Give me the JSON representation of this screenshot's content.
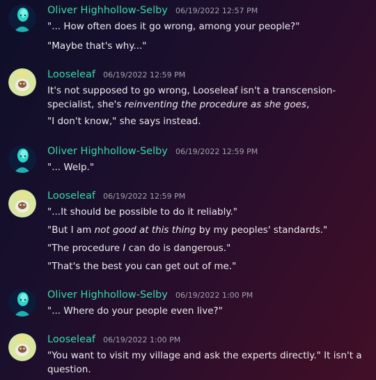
{
  "messages": [
    {
      "author": "Oliver Highhollow-Selby",
      "timestamp": "06/19/2022 12:57 PM",
      "lines": [
        "\"... How often does it go wrong, among your people?\"",
        "\"Maybe that's why...\""
      ]
    },
    {
      "author": "Looseleaf",
      "timestamp": "06/19/2022 12:59 PM",
      "lines": [
        {
          "pre": "It's not supposed to go wrong, Looseleaf isn't a transcension-specialist, she's ",
          "em": "reinventing the procedure as she goes",
          "post": ","
        },
        "\"I don't know,\" she says instead."
      ]
    },
    {
      "author": "Oliver Highhollow-Selby",
      "timestamp": "06/19/2022 12:59 PM",
      "lines": [
        "\"... Welp.\""
      ]
    },
    {
      "author": "Looseleaf",
      "timestamp": "06/19/2022 12:59 PM",
      "lines": [
        "\"...It should be possible to do it reliably.\"",
        {
          "pre": "\"But I am ",
          "em": "not good at this thing",
          "post": " by my peoples' standards.\""
        },
        {
          "pre": "\"The procedure ",
          "em": "I",
          "post": " can do is dangerous.\""
        },
        "\"That's the best you can get out of me.\""
      ]
    },
    {
      "author": "Oliver Highhollow-Selby",
      "timestamp": "06/19/2022 1:00 PM",
      "lines": [
        "\"... Where do your people even live?\""
      ]
    },
    {
      "author": "Looseleaf",
      "timestamp": "06/19/2022 1:00 PM",
      "lines": [
        "\"You want to visit my village and ask the experts directly.\" It isn't a question."
      ]
    }
  ],
  "colors": {
    "username": "#38d9a9",
    "timestamp": "#a0a3ab",
    "text": "#ececee"
  },
  "avatars": {
    "oliver": "teal-humanoid-avatar-icon",
    "looseleaf": "leaf-creature-avatar-icon"
  }
}
